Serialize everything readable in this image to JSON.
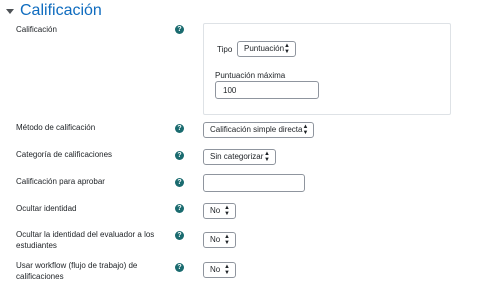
{
  "section": {
    "title": "Calificación"
  },
  "grade": {
    "label": "Calificación",
    "tipo_label": "Tipo",
    "tipo_value": "Puntuación",
    "max_label": "Puntuación máxima",
    "max_value": "100"
  },
  "fields": {
    "grading_method": {
      "label": "Método de calificación",
      "value": "Calificación simple directa"
    },
    "grade_category": {
      "label": "Categoría de calificaciones",
      "value": "Sin categorizar"
    },
    "grade_to_pass": {
      "label": "Calificación para aprobar",
      "value": ""
    },
    "hide_identity": {
      "label": "Ocultar identidad",
      "value": "No"
    },
    "hide_grader": {
      "label": "Ocultar la identidad del evaluador a los estudiantes",
      "value": "No"
    },
    "workflow": {
      "label": "Usar workflow (flujo de trabajo) de calificaciones",
      "value": "No"
    }
  },
  "help_icon_glyph": "?",
  "icons": {
    "section_toggle": "caret-down-icon",
    "help": "question-circle-icon",
    "select_arrows": "sort-arrows-icon"
  },
  "colors": {
    "title": "#0f6cbf",
    "help_icon": "#1a6b6f",
    "border": "#8f959e",
    "panel_border": "#dee2e6"
  }
}
